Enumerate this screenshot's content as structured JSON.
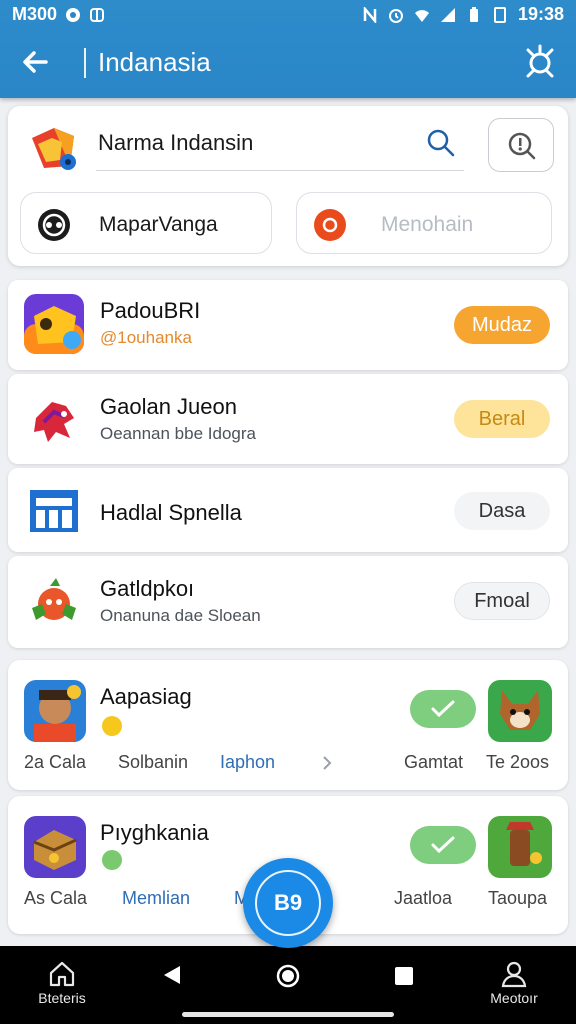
{
  "status_bar": {
    "carrier": "M300",
    "time": "19:38"
  },
  "app_bar": {
    "title": "Indanasia"
  },
  "search": {
    "value": "Narma Indansin"
  },
  "chips": [
    {
      "label": "MaparVanga"
    },
    {
      "label": "Menohain"
    }
  ],
  "list": [
    {
      "title": "PadouBRI",
      "subtitle": "@1ouhanka",
      "action": "Mudaz"
    },
    {
      "title": "Gaolan Jueon",
      "subtitle": "Oeannan bbe Idogra",
      "action": "Beral"
    },
    {
      "title": "Hadlal Spnella",
      "subtitle": "",
      "action": "Dasa"
    },
    {
      "title": "Gatldpkoı",
      "subtitle": "Onanuna dae Sloean",
      "action": "Fmoal"
    }
  ],
  "cards": [
    {
      "title": "Aapasiag",
      "footer": [
        "2a Cala",
        "Solbanin",
        "Iaphon",
        "Gamtat",
        "Te 2oos"
      ]
    },
    {
      "title": "Pıyghkania",
      "footer": [
        "As Cala",
        "Memlian",
        "M",
        "Jaatloa",
        "Taoupa"
      ]
    }
  ],
  "fab": {
    "label": "B9"
  },
  "bottom_nav": [
    {
      "label": "Bteteris",
      "icon": "home-icon"
    },
    {
      "label": "Meotoır",
      "icon": "person-icon"
    }
  ],
  "colors": {
    "app_bar": "#2a86c7",
    "accent_orange": "#f7a531",
    "accent_yellow": "#fde49a",
    "accent_green": "#7fce7f",
    "link_blue": "#2f6db5",
    "fab": "#1a8ae6"
  }
}
